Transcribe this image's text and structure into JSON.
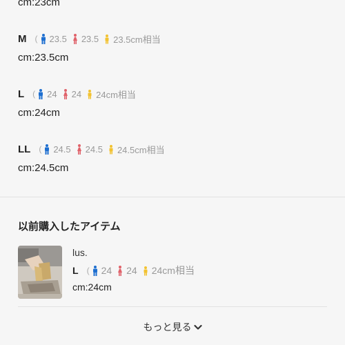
{
  "sizes": [
    {
      "cm": "cm:23cm"
    },
    {
      "name": "M",
      "paren": "(",
      "men": "23.5",
      "women": "23.5",
      "kids": "23.5cm相当",
      "cm": "cm:23.5cm"
    },
    {
      "name": "L",
      "paren": "(",
      "men": "24",
      "women": "24",
      "kids": "24cm相当",
      "cm": "cm:24cm"
    },
    {
      "name": "LL",
      "paren": "(",
      "men": "24.5",
      "women": "24.5",
      "kids": "24.5cm相当",
      "cm": "cm:24.5cm"
    }
  ],
  "history": {
    "title": "以前購入したアイテム",
    "item": {
      "brand": "lus.",
      "size_name": "L",
      "paren": "(",
      "men": "24",
      "women": "24",
      "kids": "24cm相当",
      "cm": "cm:24cm"
    },
    "more_label": "もっと見る"
  },
  "colors": {
    "men_icon": "#1e6fd0",
    "women_icon": "#e0626a",
    "kids_icon": "#f2c230",
    "muted_text": "#999999"
  },
  "icons": [
    "man-icon",
    "woman-icon",
    "child-icon",
    "chevron-down-icon"
  ]
}
